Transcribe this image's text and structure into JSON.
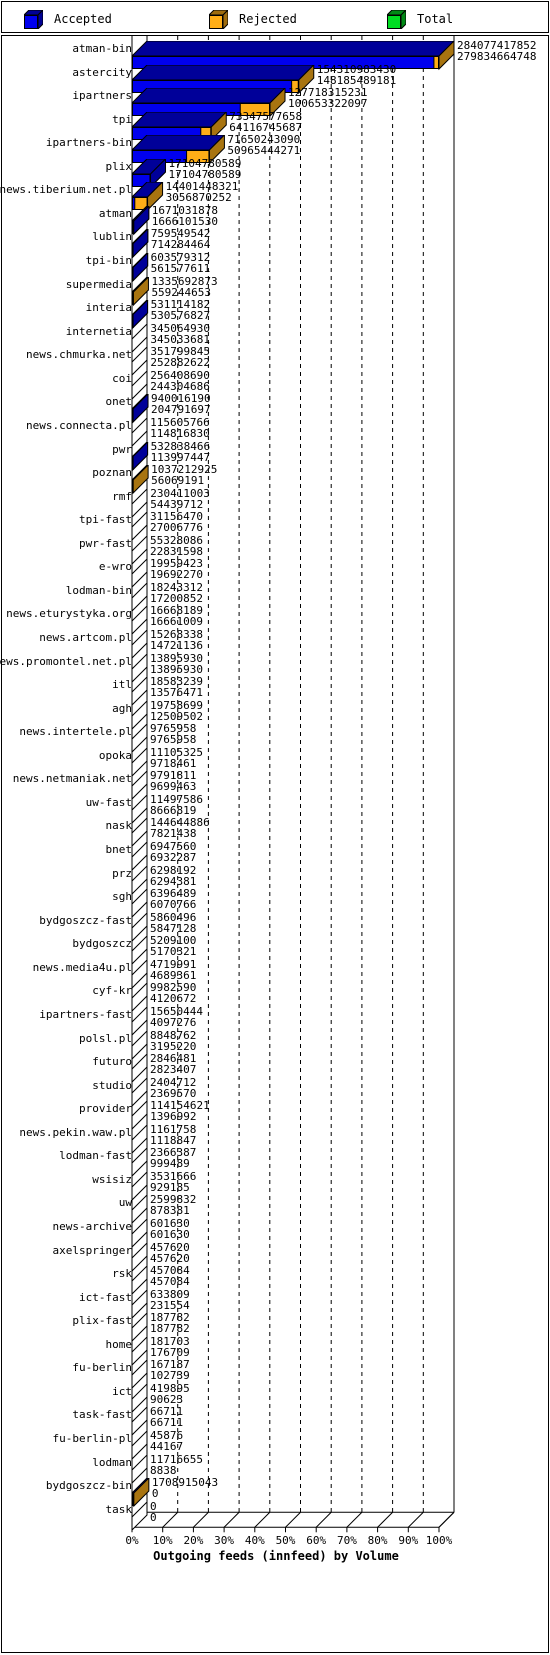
{
  "legend": {
    "items": [
      {
        "label": "Accepted",
        "color": "#0000ee",
        "icon": "cube-icon"
      },
      {
        "label": "Rejected",
        "color": "#ffae17",
        "icon": "cube-icon"
      },
      {
        "label": "Total",
        "color": "#00dd22",
        "icon": "cube-icon"
      }
    ]
  },
  "axis": {
    "title": "Outgoing feeds (innfeed) by Volume",
    "ticks": [
      "0%",
      "10%",
      "20%",
      "30%",
      "40%",
      "50%",
      "60%",
      "70%",
      "80%",
      "90%",
      "100%"
    ]
  },
  "chart_data": {
    "type": "bar",
    "orientation": "horizontal",
    "title": "Outgoing feeds (innfeed) by Volume",
    "xlabel": "Outgoing feeds (innfeed) by Volume",
    "ylabel": "",
    "xlim": [
      0,
      100
    ],
    "xunit": "percent of maximum total",
    "grid": true,
    "legend_position": "top",
    "max_total": 284077417852,
    "series": [
      {
        "name": "Accepted",
        "color": "#0000ee"
      },
      {
        "name": "Rejected",
        "color": "#ffae17"
      },
      {
        "name": "Total",
        "color": "#00dd22"
      }
    ],
    "categories": [
      "atman-bin",
      "astercity",
      "ipartners",
      "tpi",
      "ipartners-bin",
      "plix",
      "news.tiberium.net.pl",
      "atman",
      "lublin",
      "tpi-bin",
      "supermedia",
      "interia",
      "internetia",
      "news.chmurka.net",
      "coi",
      "onet",
      "news.connecta.pl",
      "pwr",
      "poznan",
      "rmf",
      "tpi-fast",
      "pwr-fast",
      "e-wro",
      "lodman-bin",
      "news.eturystyka.org",
      "news.artcom.pl",
      "news.promontel.net.pl",
      "itl",
      "agh",
      "news.intertele.pl",
      "opoka",
      "news.netmaniak.net",
      "uw-fast",
      "nask",
      "bnet",
      "prz",
      "sgh",
      "bydgoszcz-fast",
      "bydgoszcz",
      "news.media4u.pl",
      "cyf-kr",
      "ipartners-fast",
      "polsl.pl",
      "futuro",
      "studio",
      "provider",
      "news.pekin.waw.pl",
      "lodman-fast",
      "wsisiz",
      "uw",
      "news-archive",
      "axelspringer",
      "rsk",
      "ict-fast",
      "plix-fast",
      "home",
      "fu-berlin",
      "ict",
      "task-fast",
      "fu-berlin-pl",
      "lodman",
      "bydgoszcz-bin",
      "task"
    ],
    "rows": [
      {
        "name": "atman-bin",
        "total": 284077417852,
        "accepted": 279834664748
      },
      {
        "name": "astercity",
        "total": 154310983430,
        "accepted": 148185489181
      },
      {
        "name": "ipartners",
        "total": 127718315231,
        "accepted": 100653322097
      },
      {
        "name": "tpi",
        "total": 73347577658,
        "accepted": 64116745687
      },
      {
        "name": "ipartners-bin",
        "total": 71650243090,
        "accepted": 50965444271
      },
      {
        "name": "plix",
        "total": 17104780589,
        "accepted": 17104780589
      },
      {
        "name": "news.tiberium.net.pl",
        "total": 14401448321,
        "accepted": 3056870252
      },
      {
        "name": "atman",
        "total": 1671031878,
        "accepted": 1666101530
      },
      {
        "name": "lublin",
        "total": 759549542,
        "accepted": 714284464
      },
      {
        "name": "tpi-bin",
        "total": 603579312,
        "accepted": 561577611
      },
      {
        "name": "supermedia",
        "total": 1335692873,
        "accepted": 559244653
      },
      {
        "name": "interia",
        "total": 531114182,
        "accepted": 530576827
      },
      {
        "name": "internetia",
        "total": 345064930,
        "accepted": 345033681
      },
      {
        "name": "news.chmurka.net",
        "total": 351799845,
        "accepted": 252882622
      },
      {
        "name": "coi",
        "total": 256408690,
        "accepted": 244304686
      },
      {
        "name": "onet",
        "total": 940016190,
        "accepted": 204791697
      },
      {
        "name": "news.connecta.pl",
        "total": 115605766,
        "accepted": 114816830
      },
      {
        "name": "pwr",
        "total": 532838466,
        "accepted": 113997447
      },
      {
        "name": "poznan",
        "total": 1037212925,
        "accepted": 56069191
      },
      {
        "name": "rmf",
        "total": 230411003,
        "accepted": 54439712
      },
      {
        "name": "tpi-fast",
        "total": 31156470,
        "accepted": 27006776
      },
      {
        "name": "pwr-fast",
        "total": 55328086,
        "accepted": 22831598
      },
      {
        "name": "e-wro",
        "total": 19959423,
        "accepted": 19692270
      },
      {
        "name": "lodman-bin",
        "total": 18243312,
        "accepted": 17200852
      },
      {
        "name": "news.eturystyka.org",
        "total": 16668189,
        "accepted": 16661009
      },
      {
        "name": "news.artcom.pl",
        "total": 15268338,
        "accepted": 14721136
      },
      {
        "name": "news.promontel.net.pl",
        "total": 13895930,
        "accepted": 13895930
      },
      {
        "name": "itl",
        "total": 18583239,
        "accepted": 13576471
      },
      {
        "name": "agh",
        "total": 19758699,
        "accepted": 12509502
      },
      {
        "name": "news.intertele.pl",
        "total": 9765958,
        "accepted": 9765958
      },
      {
        "name": "opoka",
        "total": 11105325,
        "accepted": 9718461
      },
      {
        "name": "news.netmaniak.net",
        "total": 9791811,
        "accepted": 9699463
      },
      {
        "name": "uw-fast",
        "total": 11497586,
        "accepted": 8666819
      },
      {
        "name": "nask",
        "total": 144644886,
        "accepted": 7821438
      },
      {
        "name": "bnet",
        "total": 6947560,
        "accepted": 6932287
      },
      {
        "name": "prz",
        "total": 6298192,
        "accepted": 6294381
      },
      {
        "name": "sgh",
        "total": 6396489,
        "accepted": 6070766
      },
      {
        "name": "bydgoszcz-fast",
        "total": 5860496,
        "accepted": 5847128
      },
      {
        "name": "bydgoszcz",
        "total": 5209100,
        "accepted": 5170321
      },
      {
        "name": "news.media4u.pl",
        "total": 4719991,
        "accepted": 4689361
      },
      {
        "name": "cyf-kr",
        "total": 9982590,
        "accepted": 4120672
      },
      {
        "name": "ipartners-fast",
        "total": 15650444,
        "accepted": 4097276
      },
      {
        "name": "polsl.pl",
        "total": 8848762,
        "accepted": 3195220
      },
      {
        "name": "futuro",
        "total": 2846481,
        "accepted": 2823407
      },
      {
        "name": "studio",
        "total": 2404712,
        "accepted": 2369570
      },
      {
        "name": "provider",
        "total": 114154621,
        "accepted": 1396992
      },
      {
        "name": "news.pekin.waw.pl",
        "total": 1161758,
        "accepted": 1118847
      },
      {
        "name": "lodman-fast",
        "total": 2366387,
        "accepted": 999489
      },
      {
        "name": "wsisiz",
        "total": 3531666,
        "accepted": 929185
      },
      {
        "name": "uw",
        "total": 2599832,
        "accepted": 878381
      },
      {
        "name": "news-archive",
        "total": 601630,
        "accepted": 601630
      },
      {
        "name": "axelspringer",
        "total": 457620,
        "accepted": 457620
      },
      {
        "name": "rsk",
        "total": 457084,
        "accepted": 457084
      },
      {
        "name": "ict-fast",
        "total": 633809,
        "accepted": 231554
      },
      {
        "name": "plix-fast",
        "total": 187782,
        "accepted": 187782
      },
      {
        "name": "home",
        "total": 181703,
        "accepted": 176709
      },
      {
        "name": "fu-berlin",
        "total": 167187,
        "accepted": 102739
      },
      {
        "name": "ict",
        "total": 419895,
        "accepted": 90623
      },
      {
        "name": "task-fast",
        "total": 66711,
        "accepted": 66711
      },
      {
        "name": "fu-berlin-pl",
        "total": 45876,
        "accepted": 44167
      },
      {
        "name": "lodman",
        "total": 11716655,
        "accepted": 8838
      },
      {
        "name": "bydgoszcz-bin",
        "total": 1708915043,
        "accepted": 0
      },
      {
        "name": "task",
        "total": 0,
        "accepted": 0
      }
    ]
  },
  "colors": {
    "accepted": "#0000ee",
    "accepted_dark": "#000099",
    "rejected": "#ffae17",
    "rejected_dark": "#a87410",
    "total": "#00dd22",
    "total_dark": "#009916",
    "outline": "#000000",
    "background": "#ffffff",
    "grid": "#000000"
  }
}
